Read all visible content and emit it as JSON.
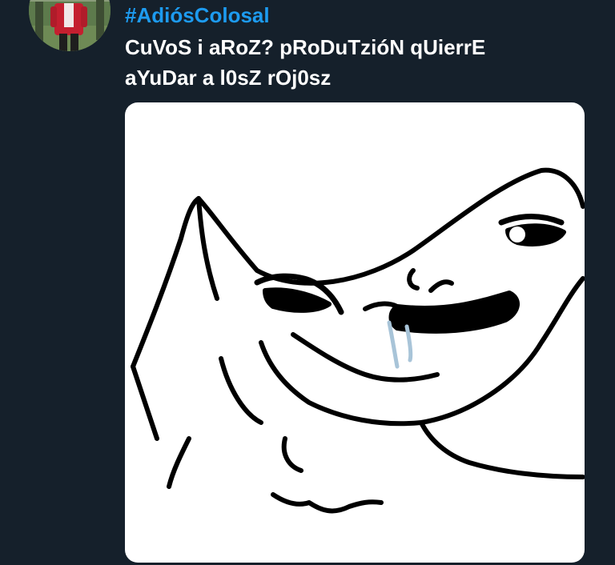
{
  "tweet": {
    "hashtag": "#AdiósColosal",
    "text_lines": [
      "CuVoS i aRoZ? pRoDuTzióN qUierrE",
      "aYuDar a l0sZ rOj0sz"
    ]
  },
  "media": {
    "type": "image",
    "subject": "wojak-brainlet-drooling-meme"
  },
  "colors": {
    "background": "#15202b",
    "hashtag": "#1d9bf0",
    "text": "#ffffff",
    "media_bg": "#ffffff"
  }
}
